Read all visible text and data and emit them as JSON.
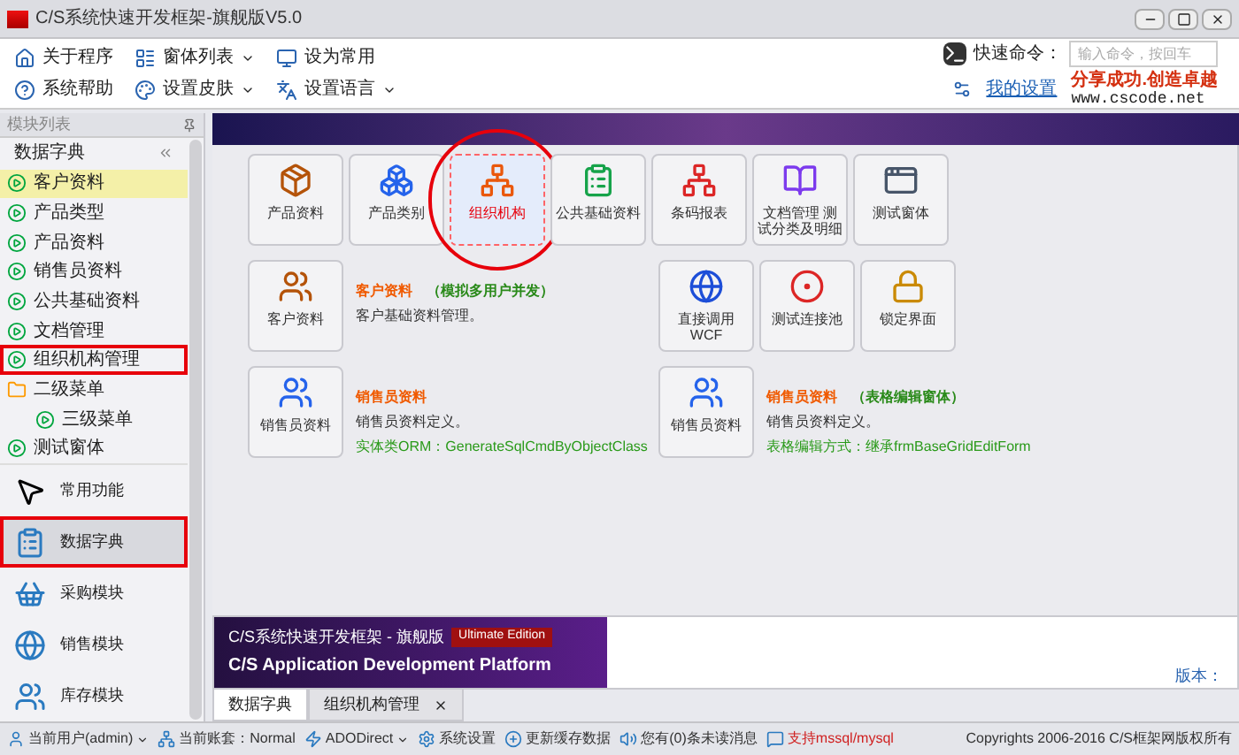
{
  "window": {
    "title": "C/S系统快速开发框架-旗舰版V5.0"
  },
  "toolbar": {
    "rows": [
      [
        {
          "label": "关于程序",
          "dropdown": false
        },
        {
          "label": "窗体列表",
          "dropdown": true
        },
        {
          "label": "设为常用",
          "dropdown": false
        }
      ],
      [
        {
          "label": "系统帮助",
          "dropdown": false
        },
        {
          "label": "设置皮肤",
          "dropdown": true
        },
        {
          "label": "设置语言",
          "dropdown": true
        }
      ]
    ]
  },
  "quick_command": {
    "label": "快速命令：",
    "placeholder": "输入命令，按回车"
  },
  "my_settings_link": "我的设置",
  "slogan": {
    "line_1": "分享成功.创造卓越",
    "line_2": "www.cscode.net"
  },
  "sidebar": {
    "title": "模块列表",
    "group": "数据字典",
    "tree": [
      {
        "label": "客户资料",
        "kind": "item",
        "selected": true,
        "annotated": false
      },
      {
        "label": "产品类型",
        "kind": "item",
        "selected": false,
        "annotated": false
      },
      {
        "label": "产品资料",
        "kind": "item",
        "selected": false,
        "annotated": false
      },
      {
        "label": "销售员资料",
        "kind": "item",
        "selected": false,
        "annotated": false
      },
      {
        "label": "公共基础资料",
        "kind": "item",
        "selected": false,
        "annotated": false
      },
      {
        "label": "文档管理",
        "kind": "item",
        "selected": false,
        "annotated": false
      },
      {
        "label": "组织机构管理",
        "kind": "item",
        "selected": false,
        "annotated": true
      },
      {
        "label": "二级菜单",
        "kind": "folder",
        "selected": false,
        "annotated": false,
        "children": [
          {
            "label": "三级菜单",
            "kind": "item",
            "selected": false,
            "annotated": false
          }
        ]
      },
      {
        "label": "测试窗体",
        "kind": "item",
        "selected": false,
        "annotated": false
      }
    ],
    "modules": [
      {
        "label": "常用功能",
        "selected": false,
        "annotated": false
      },
      {
        "label": "数据字典",
        "selected": true,
        "annotated": true
      },
      {
        "label": "采购模块",
        "selected": false,
        "annotated": false
      },
      {
        "label": "销售模块",
        "selected": false,
        "annotated": false
      },
      {
        "label": "库存模块",
        "selected": false,
        "annotated": false
      }
    ]
  },
  "content": {
    "rows": [
      {
        "items": [
          {
            "kind": "tile",
            "label": "产品资料",
            "selected": false,
            "circled": false
          },
          {
            "kind": "tile",
            "label": "产品类别",
            "selected": false,
            "circled": false
          },
          {
            "kind": "tile",
            "label": "组织机构",
            "selected": true,
            "circled": true
          },
          {
            "kind": "tile",
            "label": "公共基础资料",
            "selected": false,
            "circled": false
          },
          {
            "kind": "tile",
            "label": "条码报表",
            "selected": false,
            "circled": false
          },
          {
            "kind": "tile",
            "label": "文档管理 测试分类及明细",
            "selected": false,
            "circled": false
          },
          {
            "kind": "tile",
            "label": "测试窗体",
            "selected": false,
            "circled": false
          }
        ]
      },
      {
        "items": [
          {
            "kind": "tile",
            "label": "客户资料",
            "selected": false,
            "circled": false
          },
          {
            "kind": "info",
            "title": "客户资料",
            "note": "（模拟多用户并发）",
            "lines": [
              {
                "text": "客户基础资料管理。",
                "kind": "plain"
              }
            ]
          },
          {
            "kind": "tile",
            "label": "直接调用WCF",
            "selected": false,
            "circled": false
          },
          {
            "kind": "tile",
            "label": "测试连接池",
            "selected": false,
            "circled": false
          },
          {
            "kind": "tile",
            "label": "锁定界面",
            "selected": false,
            "circled": false
          }
        ]
      },
      {
        "items": [
          {
            "kind": "tile",
            "label": "销售员资料",
            "selected": false,
            "circled": false
          },
          {
            "kind": "info",
            "title": "销售员资料",
            "lines": [
              {
                "text": "销售员资料定义。",
                "kind": "plain"
              },
              {
                "text": "实体类ORM：GenerateSqlCmdByObjectClass",
                "kind": "green"
              }
            ]
          },
          {
            "kind": "tile",
            "label": "销售员资料",
            "selected": false,
            "circled": false
          },
          {
            "kind": "info",
            "title": "销售员资料",
            "note": "（表格编辑窗体）",
            "lines": [
              {
                "text": "销售员资料定义。",
                "kind": "plain"
              },
              {
                "text": "表格编辑方式：继承frmBaseGridEditForm",
                "kind": "green"
              }
            ]
          }
        ]
      }
    ]
  },
  "banner": {
    "title": "C/S系统快速开发框架 - 旗舰版",
    "edition": "Ultimate Edition",
    "subtitle": "C/S Application Development Platform"
  },
  "version_label": "版本：",
  "tabs": [
    {
      "label": "数据字典",
      "selected": true,
      "closable": false
    },
    {
      "label": "组织机构管理",
      "selected": false,
      "closable": true
    }
  ],
  "status_bar": {
    "items": [
      {
        "label": "当前用户(admin)",
        "dropdown": true,
        "kind": "normal"
      },
      {
        "label": "当前账套：Normal",
        "dropdown": false,
        "kind": "normal"
      },
      {
        "label": "ADODirect",
        "dropdown": true,
        "kind": "normal"
      },
      {
        "label": "系统设置",
        "dropdown": false,
        "kind": "normal"
      },
      {
        "label": "更新缓存数据",
        "dropdown": false,
        "kind": "normal"
      },
      {
        "label": "您有(0)条未读消息",
        "dropdown": false,
        "kind": "normal"
      },
      {
        "label": "支持mssql/mysql",
        "dropdown": false,
        "kind": "alert"
      }
    ],
    "copyright": "Copyrights 2006-2016 C/S框架网版权所有"
  }
}
